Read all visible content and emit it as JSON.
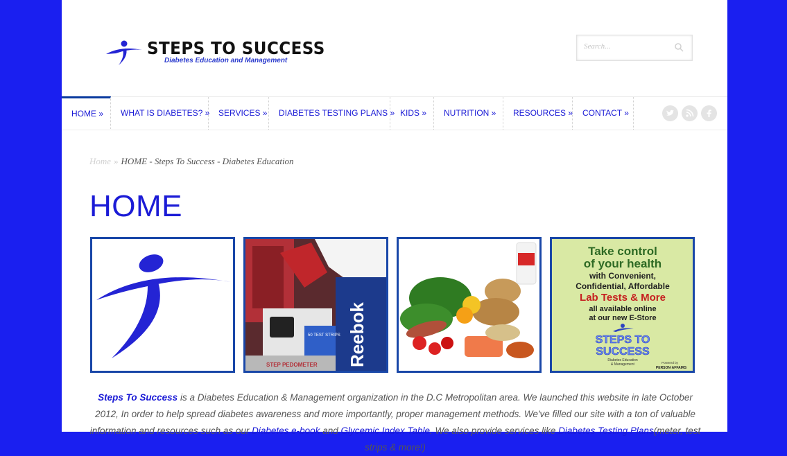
{
  "site": {
    "logo_title": "STEPS TO SUCCESS",
    "logo_subtitle": "Diabetes Education and Management",
    "search_placeholder": "Search..."
  },
  "nav": {
    "items": [
      {
        "label": "HOME »"
      },
      {
        "label": "WHAT IS DIABETES? »"
      },
      {
        "label": "SERVICES »"
      },
      {
        "label": "DIABETES TESTING PLANS »"
      },
      {
        "label": "KIDS »"
      },
      {
        "label": "NUTRITION »"
      },
      {
        "label": "RESOURCES »"
      },
      {
        "label": "CONTACT »"
      }
    ],
    "social": [
      "twitter-icon",
      "rss-icon",
      "facebook-icon"
    ]
  },
  "breadcrumb": {
    "home": "Home",
    "separator": "»",
    "current": "HOME - Steps To Success - Diabetes Education"
  },
  "page_title": "HOME",
  "tiles": {
    "t2": {
      "brand": "Reebok",
      "meter": "50 TEST STRIPS",
      "pedometer": "STEP PEDOMETER"
    },
    "t4": {
      "line1": "Take control",
      "line2": "of your health",
      "line3": "with Convenient,",
      "line4": "Confidential, Affordable",
      "line5": "Lab Tests & More",
      "line6": "all available online",
      "line7": "at our new E-Store",
      "logo_a": "STEPS TO",
      "logo_b": "SUCCESS",
      "logo_c": "Diabetes Education",
      "logo_d": "& Management",
      "powered": "Powered by",
      "partner": "PERSON·AFFAIRS"
    }
  },
  "intro": {
    "brand": "Steps To Success",
    "t1": " is a Diabetes Education & Management organization in the D.C Metropolitan area. We launched this website in late October 2012, In order to help spread diabetes awareness and more importantly, proper management methods. We've filled our site with a ton of valuable information and resources such as our ",
    "link1": "Diabetes e-book",
    "t2": " and ",
    "link2": "Glycemic Index Table",
    "t3": ". We also provide services like ",
    "link3": "Diabetes Testing Plans",
    "t4": "(meter, test strips & more!)"
  },
  "colors": {
    "background": "#1a1ff0",
    "accent": "#1b1bd6",
    "tile_border": "#1947a8"
  }
}
